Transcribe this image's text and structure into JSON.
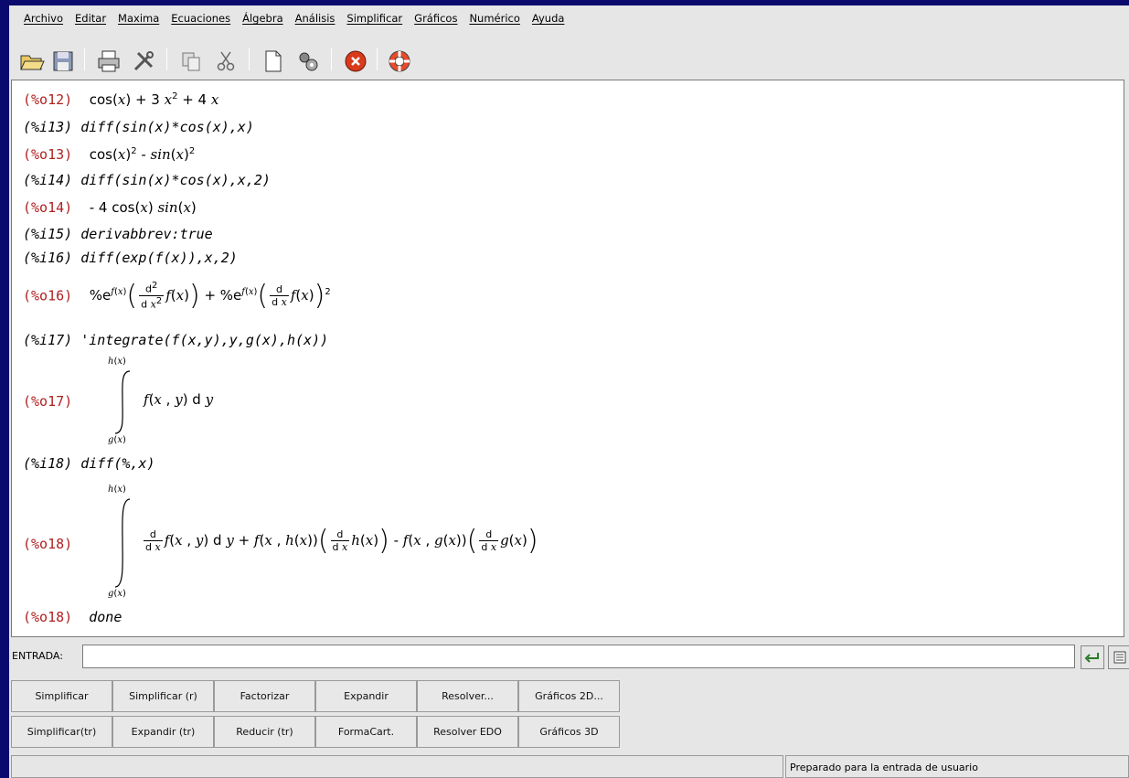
{
  "menu": [
    "Archivo",
    "Editar",
    "Maxima",
    "Ecuaciones",
    "Álgebra",
    "Análisis",
    "Simplificar",
    "Gráficos",
    "Numérico",
    "Ayuda"
  ],
  "console": {
    "o12": {
      "label": "(%o12)"
    },
    "i13": {
      "label": "(%i13)",
      "text": "diff(sin(x)*cos(x),x)"
    },
    "o13": {
      "label": "(%o13)"
    },
    "i14": {
      "label": "(%i14)",
      "text": "diff(sin(x)*cos(x),x,2)"
    },
    "o14": {
      "label": "(%o14)"
    },
    "i15": {
      "label": "(%i15)",
      "text": "derivabbrev:true"
    },
    "i16": {
      "label": "(%i16)",
      "text": "diff(exp(f(x)),x,2)"
    },
    "o16": {
      "label": "(%o16)"
    },
    "i17": {
      "label": "(%i17)",
      "text": "'integrate(f(x,y),y,g(x),h(x))"
    },
    "o17": {
      "label": "(%o17)"
    },
    "i18": {
      "label": "(%i18)",
      "text": "diff(%,x)"
    },
    "o18": {
      "label": "(%o18)"
    },
    "o18b": {
      "label": "(%o18)",
      "text": "done"
    }
  },
  "entrada": {
    "label": "ENTRADA:",
    "value": ""
  },
  "buttons": {
    "row1": [
      "Simplificar",
      "Simplificar (r)",
      "Factorizar",
      "Expandir",
      "Resolver...",
      "Gráficos 2D..."
    ],
    "row2": [
      "Simplificar(tr)",
      "Expandir (tr)",
      "Reducir (tr)",
      "FormaCart.",
      "Resolver EDO",
      "Gráficos 3D"
    ]
  },
  "status": {
    "text": "Preparado para la entrada de usuario"
  },
  "colors": {
    "background": "#0a0a6e",
    "output_label": "#b02020",
    "panel": "#e6e6e6"
  }
}
